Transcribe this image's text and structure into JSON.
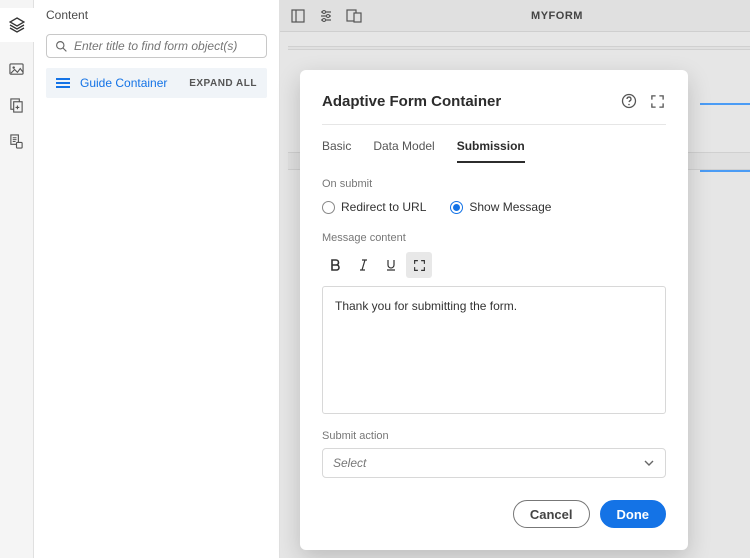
{
  "sidebar": {
    "title": "Content",
    "search_placeholder": "Enter title to find form object(s)",
    "expand_label": "EXPAND ALL",
    "item_label": "Guide Container"
  },
  "topbar": {
    "form_name": "MYFORM"
  },
  "modal": {
    "title": "Adaptive Form Container",
    "tabs": {
      "basic": "Basic",
      "data_model": "Data Model",
      "submission": "Submission"
    },
    "on_submit_label": "On submit",
    "radio_redirect": "Redirect to URL",
    "radio_message": "Show Message",
    "message_content_label": "Message content",
    "message_body": "Thank you for submitting the form.",
    "submit_action_label": "Submit action",
    "submit_action_value": "Select",
    "cancel": "Cancel",
    "done": "Done"
  }
}
